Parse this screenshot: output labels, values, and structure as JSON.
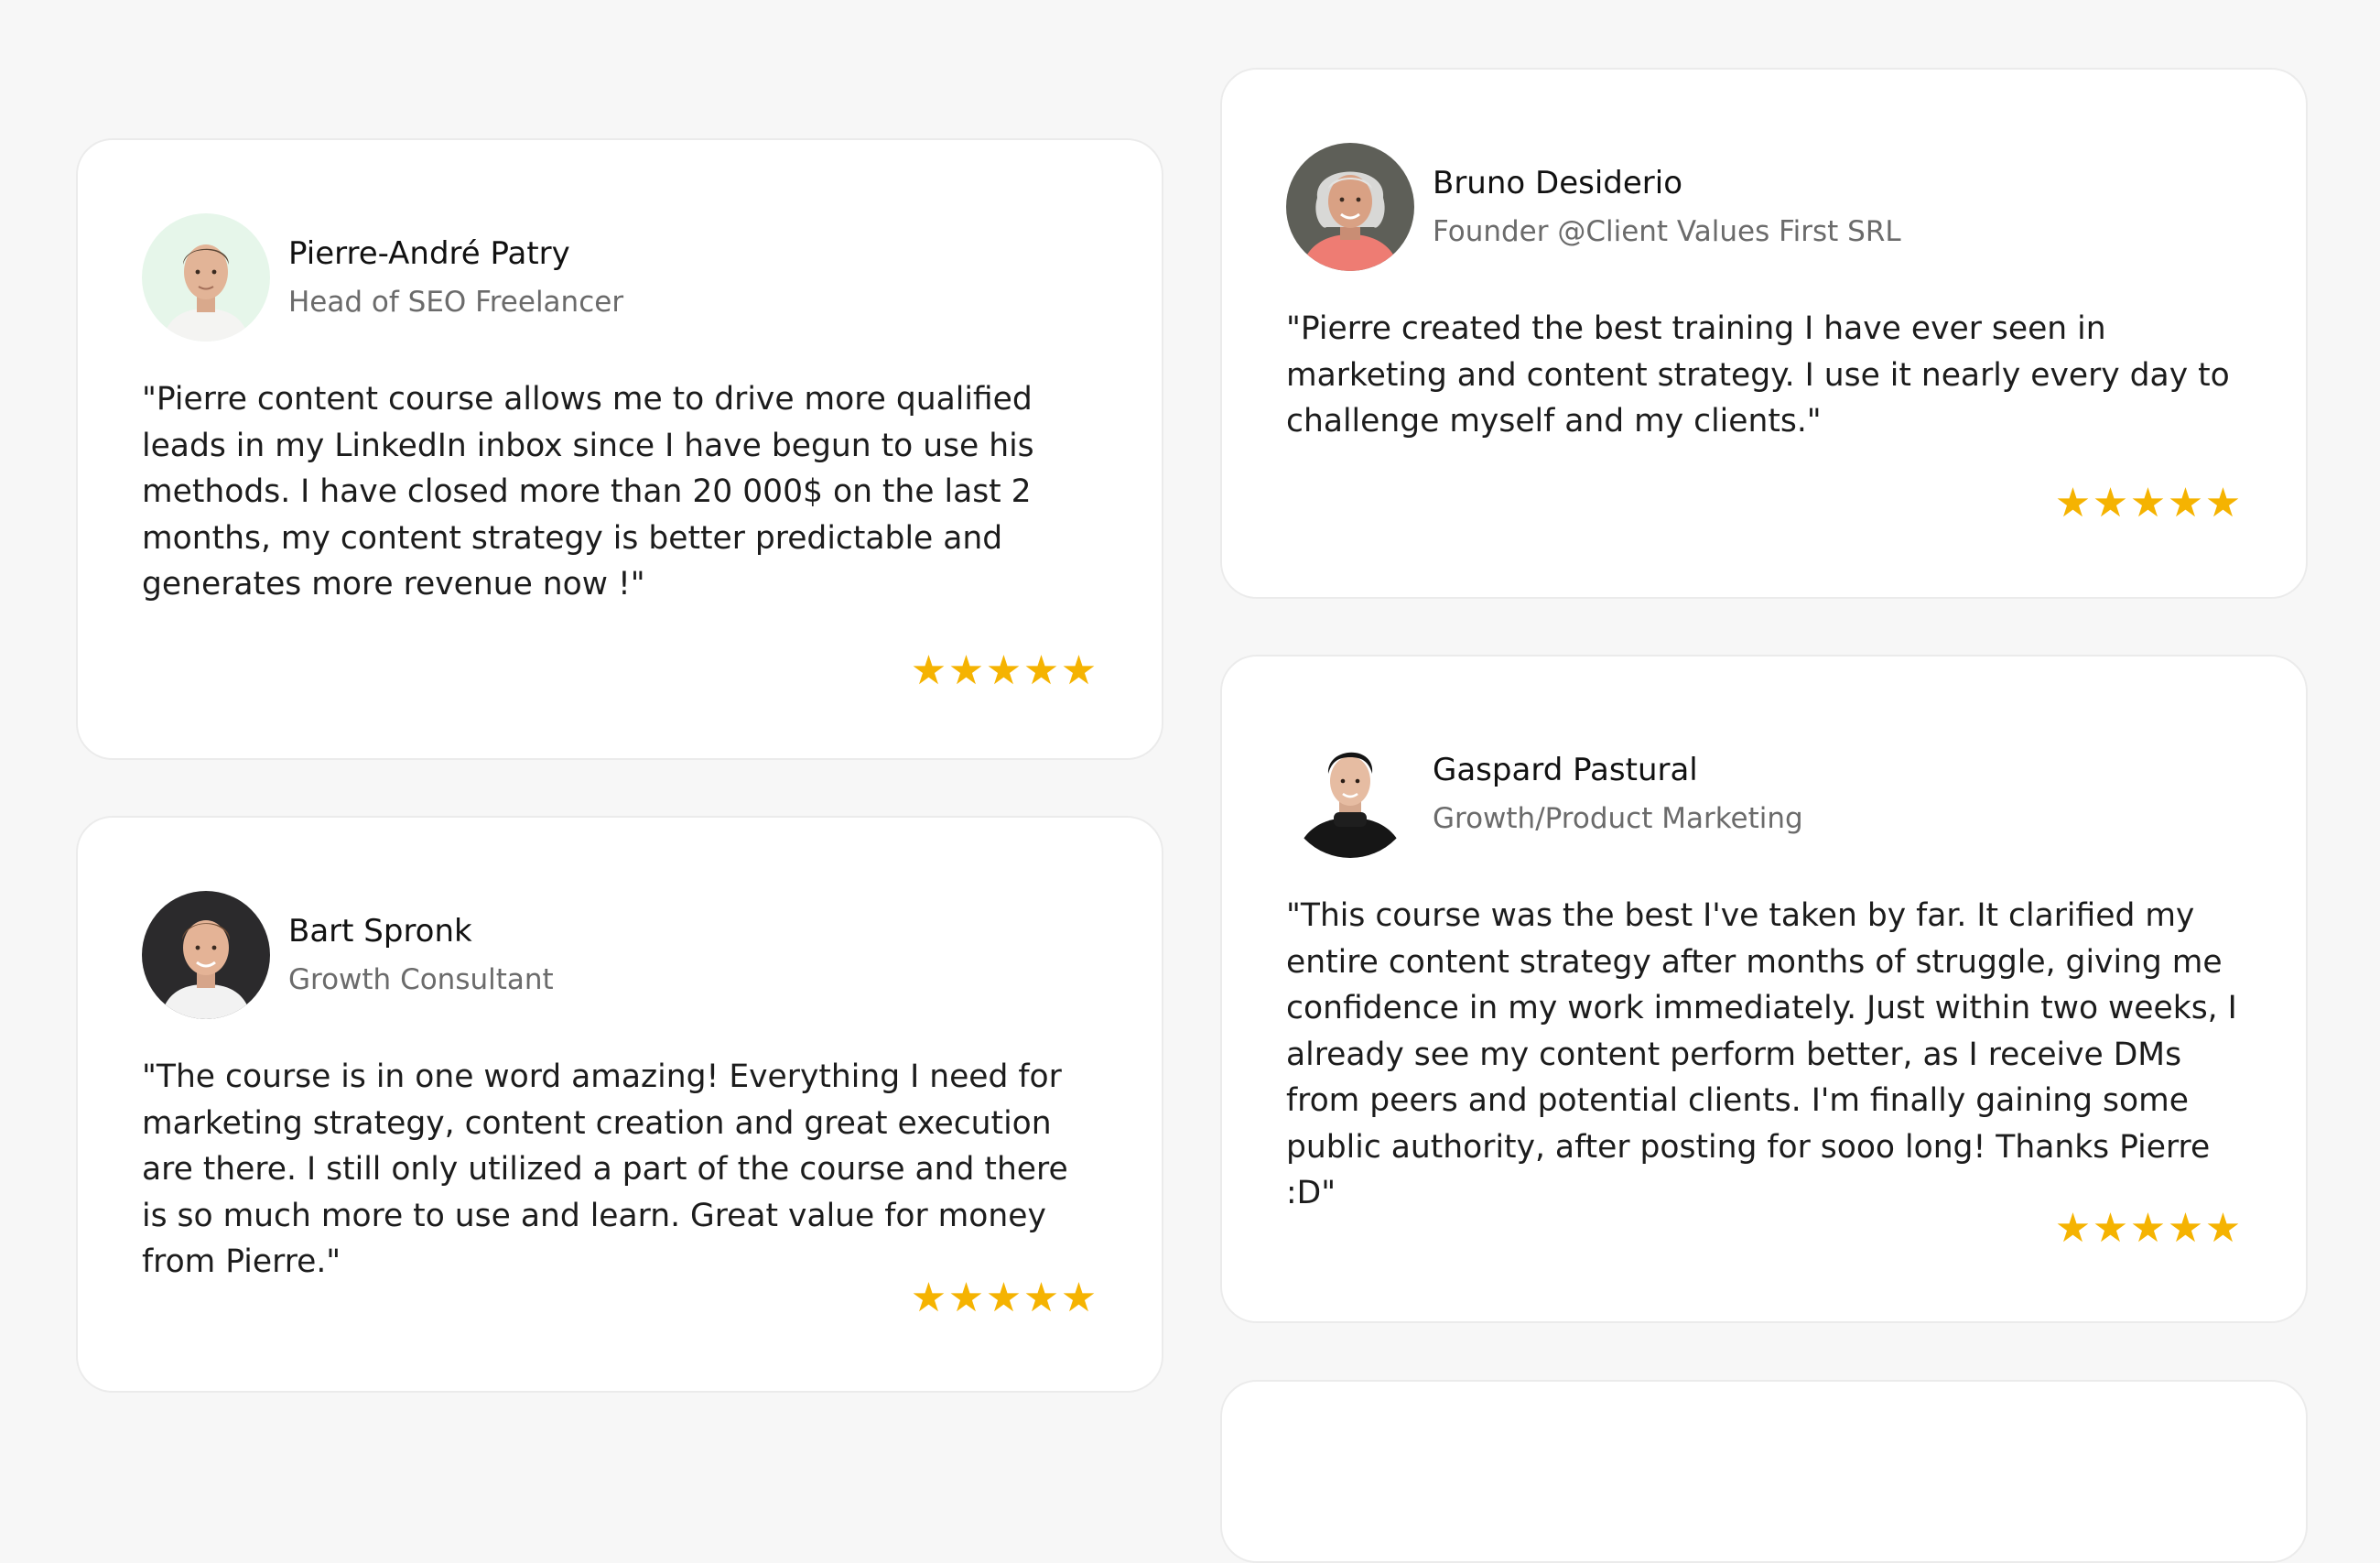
{
  "testimonials": [
    {
      "name": "Pierre-André Patry",
      "role": "Head of SEO Freelancer",
      "quote": "\"Pierre content course allows me to drive more qualified leads in my LinkedIn inbox since I have begun to use his methods. I have closed more than 20 000$ on the last 2 months, my content strategy is better predictable and generates more revenue now !\"",
      "rating": 5
    },
    {
      "name": "Bart Spronk",
      "role": "Growth Consultant",
      "quote": "\"The course is in one word amazing! Everything I need for marketing strategy, content creation and great execution are there. I still only utilized a part of the course and there is so much more to use and learn. Great value for money from Pierre.\"",
      "rating": 5
    },
    {
      "name": "Bruno Desiderio",
      "role": "Founder @Client Values First SRL",
      "quote": "\"Pierre created the best training I have ever seen in marketing and content strategy. I use it nearly every day to challenge myself and my clients.\"",
      "rating": 5
    },
    {
      "name": "Gaspard Pastural",
      "role": "Growth/Product Marketing",
      "quote": "\"This course was the best I've taken by far. It clarified my entire content strategy after months of struggle, giving me confidence in my work immediately. Just within two weeks, I already see my content perform better, as I receive DMs from peers and potential clients. I'm finally gaining some public authority, after posting for sooo long! Thanks Pierre :D\"",
      "rating": 5
    }
  ],
  "colors": {
    "page_background": "#f7f7f7",
    "card_background": "#ffffff",
    "star": "#f5b301",
    "role_text": "#6b6b6b"
  },
  "icons": {
    "star": "star-icon"
  }
}
